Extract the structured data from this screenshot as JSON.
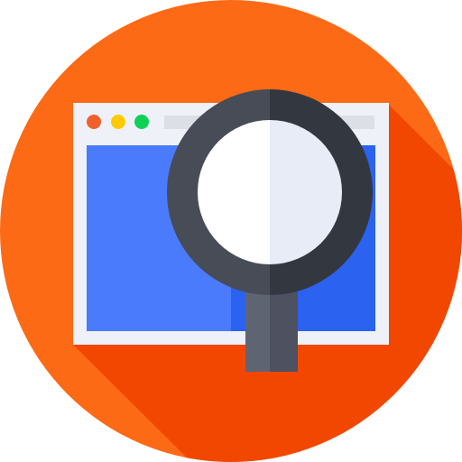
{
  "icon": {
    "name": "web-search-icon",
    "background_color": "#fd6a16",
    "shadow_color": "#f24700",
    "browser": {
      "frame_color": "#eef1f8",
      "address_bar_color": "#dcdfe6",
      "content_color_light": "#4b7bfd",
      "content_color_dark": "#2b62f0",
      "window_dots": [
        {
          "name": "close-dot-icon",
          "color": "#f1602a"
        },
        {
          "name": "minimize-dot-icon",
          "color": "#fecb02"
        },
        {
          "name": "maximize-dot-icon",
          "color": "#0ed257"
        }
      ]
    },
    "magnifier": {
      "ring_color_left": "#474c56",
      "ring_color_right": "#333840",
      "lens_color_left": "#ffffff",
      "lens_color_right": "#e7ecf6",
      "handle_color_left": "#5f6472",
      "handle_color_right": "#4d5160"
    }
  }
}
